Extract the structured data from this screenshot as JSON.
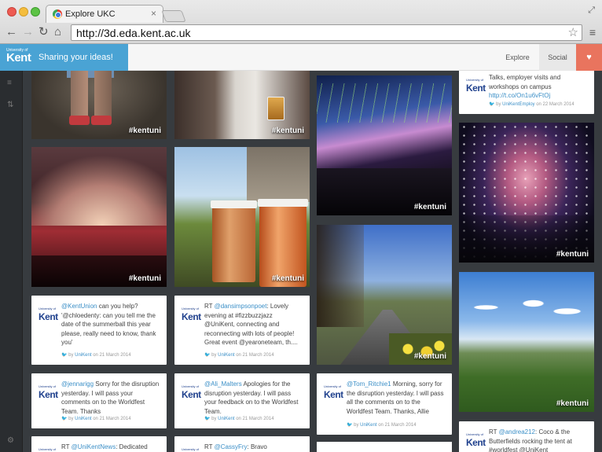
{
  "browser": {
    "tab_title": "Explore UKC",
    "tab_close": "×",
    "url": "http://3d.eda.kent.ac.uk",
    "icons": [
      "back-icon",
      "forward-icon",
      "reload-icon",
      "home-icon",
      "star-icon",
      "menu-icon",
      "fullscreen-icon"
    ]
  },
  "site": {
    "logo_small": "University of",
    "logo_main": "Kent",
    "tagline": "Sharing your ideas!",
    "nav": {
      "explore": "Explore",
      "social": "Social",
      "heart": "♥"
    },
    "accent": "#4aa3d4",
    "heart_color": "#e9745e"
  },
  "feed": {
    "hashtag": "#kentuni",
    "photo_tags": [
      "#kentuni",
      "#kentuni",
      "#kentuni",
      "#kentuni",
      "#kentuni",
      "#kentuni",
      "#kentuni",
      "#kentuni",
      "#kentuni"
    ],
    "tweets": [
      {
        "intro": "Talks, employer visits and workshops on campus ",
        "link": "http://t.co/On1u6vFtOj",
        "rest": "",
        "by": "UniKentEmploy",
        "date": "on 22 March 2014"
      },
      {
        "intro": "",
        "link": "@KentUnion",
        "rest": " can you help? '@chloedenty: can you tell me the date of the summerball this year please, really need to know, thank you'",
        "by": "UniKent",
        "date": "on 21 March 2014"
      },
      {
        "intro": "RT ",
        "link": "@dansimpsonpoet",
        "rest": ": Lovely evening at #fizzbuzzjazz @UniKent, connecting and reconnecting with lots of people! Great event @yearoneteam, th....",
        "by": "UniKent",
        "date": "on 21 March 2014"
      },
      {
        "intro": "",
        "link": "@jennarigg",
        "rest": " Sorry for the disruption yesterday. I will pass your comments on to the Worldfest Team. Thanks",
        "by": "UniKent",
        "date": "on 21 March 2014"
      },
      {
        "intro": "",
        "link": "@Ali_Malters",
        "rest": " Apologies for the disruption yesterday. I will pass your feedback on to the Worldfest Team.",
        "by": "UniKent",
        "date": "on 21 March 2014"
      },
      {
        "intro": "",
        "link": "@Tom_Ritchie1",
        "rest": " Morning, sorry for the disruption yesterday. I will pass all the comments on to the Worldfest Team. Thanks, Allie",
        "by": "UniKent",
        "date": "on 21 March 2014"
      },
      {
        "intro": "RT ",
        "link": "@UniKentNews",
        "rest": ": Dedicated",
        "by": "",
        "date": ""
      },
      {
        "intro": "RT ",
        "link": "@CassyFry",
        "rest": ": Bravo @yearoneteam",
        "by": "",
        "date": ""
      },
      {
        "intro": "RT ",
        "link": "@andrea212",
        "rest": ": Coco & the Butterfields rocking the tent at #worldfest @UniKent",
        "by": "",
        "date": ""
      }
    ],
    "by_prefix": "by",
    "tweet_logo_small": "University of",
    "tweet_logo_main": "Kent"
  }
}
